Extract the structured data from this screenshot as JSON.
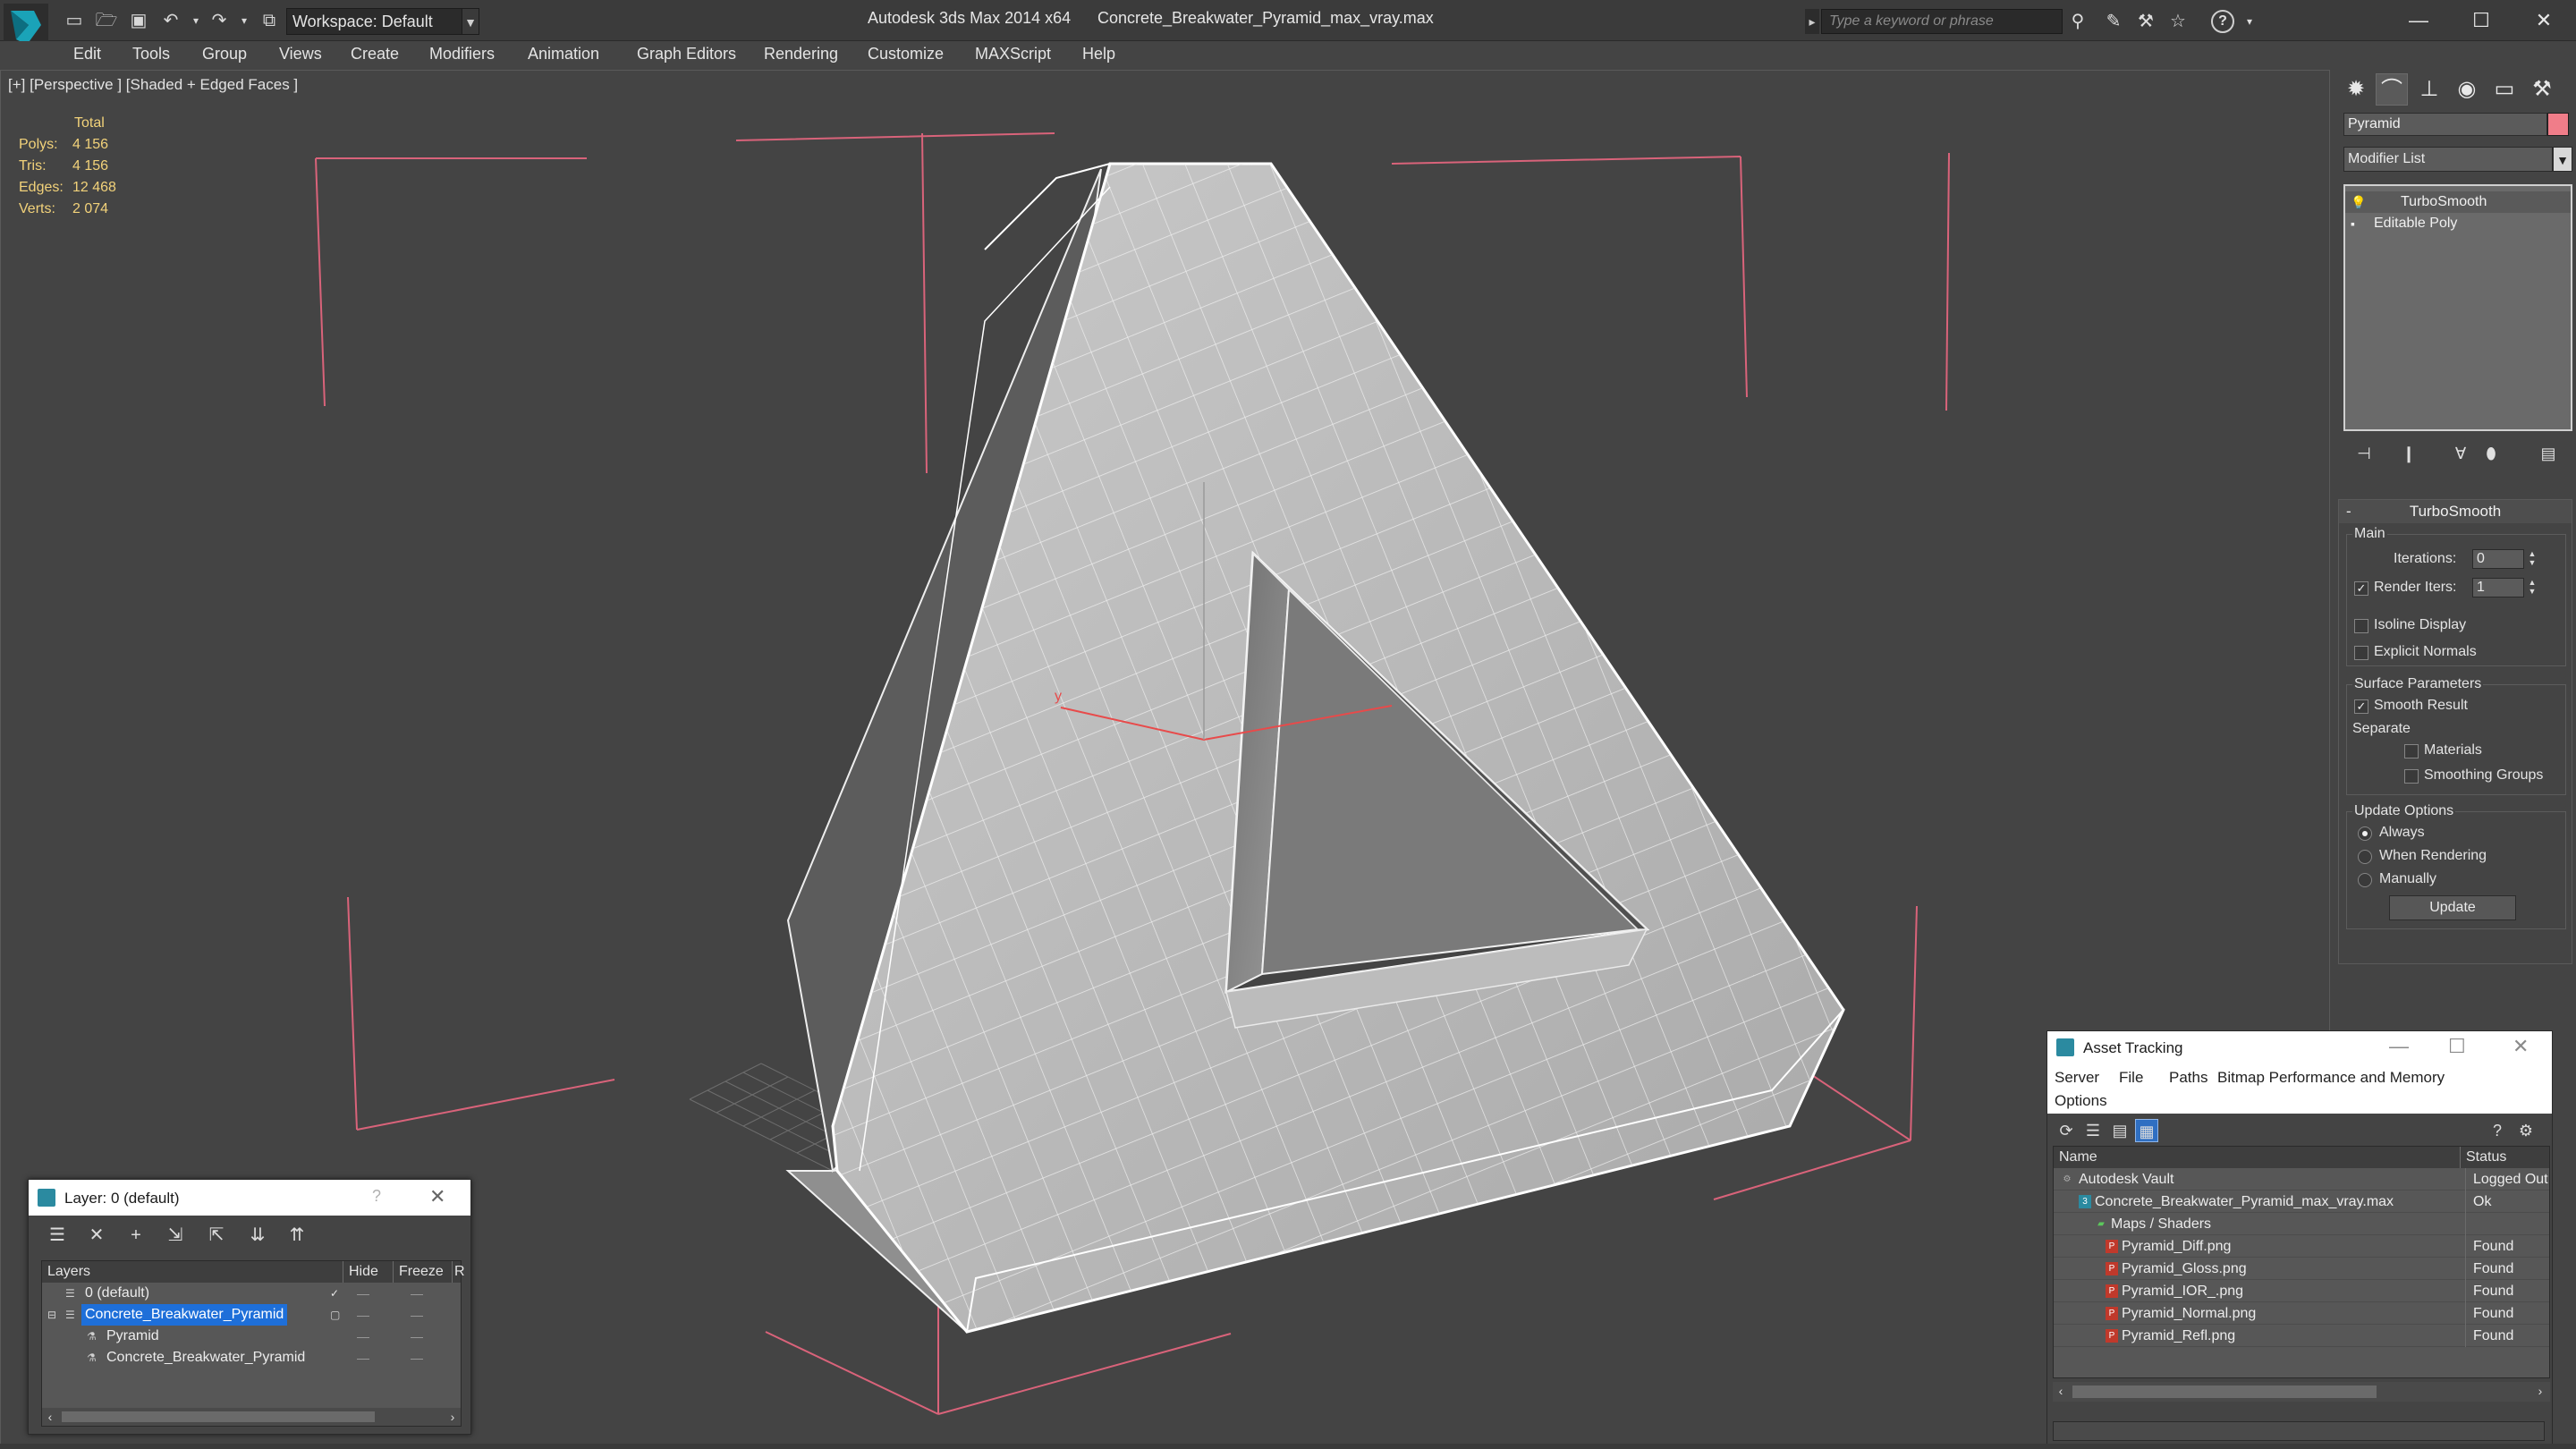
{
  "titlebar": {
    "app_title": "Autodesk 3ds Max  2014 x64",
    "file_title": "Concrete_Breakwater_Pyramid_max_vray.max",
    "workspace": "Workspace: Default",
    "search_placeholder": "Type a keyword or phrase"
  },
  "menu": [
    "Edit",
    "Tools",
    "Group",
    "Views",
    "Create",
    "Modifiers",
    "Animation",
    "Graph Editors",
    "Rendering",
    "Customize",
    "MAXScript",
    "Help"
  ],
  "viewport": {
    "label": "[+] [Perspective ] [Shaded + Edged Faces ]",
    "stats": {
      "header": "Total",
      "rows": [
        {
          "label": "Polys:",
          "value": "4 156"
        },
        {
          "label": "Tris:",
          "value": "4 156"
        },
        {
          "label": "Edges:",
          "value": "12 468"
        },
        {
          "label": "Verts:",
          "value": "2 074"
        }
      ]
    },
    "axis_label": "y"
  },
  "command_panel": {
    "object_name": "Pyramid",
    "object_color": "#f07d89",
    "modifier_list": "Modifier List",
    "stack": [
      "TurboSmooth",
      "Editable Poly"
    ],
    "turbosmooth": {
      "title": "TurboSmooth",
      "main_group": "Main",
      "iterations_label": "Iterations:",
      "iterations_value": "0",
      "render_iters_label": "Render Iters:",
      "render_iters_value": "1",
      "render_iters_checked": true,
      "isoline_label": "Isoline Display",
      "explicit_normals_label": "Explicit Normals",
      "surface_group": "Surface Parameters",
      "smooth_result_label": "Smooth Result",
      "separate_label": "Separate",
      "materials_label": "Materials",
      "smoothing_groups_label": "Smoothing Groups",
      "update_group": "Update Options",
      "always_label": "Always",
      "when_rendering_label": "When Rendering",
      "manually_label": "Manually",
      "update_button": "Update"
    }
  },
  "layer_dialog": {
    "title": "Layer: 0 (default)",
    "help": "?",
    "columns": [
      "Layers",
      "Hide",
      "Freeze",
      "R"
    ],
    "rows": [
      "0 (default)",
      "Concrete_Breakwater_Pyramid",
      "Pyramid",
      "Concrete_Breakwater_Pyramid"
    ]
  },
  "asset_dialog": {
    "title": "Asset Tracking",
    "menu": [
      "Server",
      "File",
      "Paths",
      "Bitmap Performance and Memory",
      "Options"
    ],
    "columns": [
      "Name",
      "Status"
    ],
    "rows": [
      {
        "name": "Autodesk Vault",
        "status": "Logged Out"
      },
      {
        "name": "Concrete_Breakwater_Pyramid_max_vray.max",
        "status": "Ok"
      },
      {
        "name": "Maps / Shaders",
        "status": ""
      },
      {
        "name": "Pyramid_Diff.png",
        "status": "Found"
      },
      {
        "name": "Pyramid_Gloss.png",
        "status": "Found"
      },
      {
        "name": "Pyramid_IOR_.png",
        "status": "Found"
      },
      {
        "name": "Pyramid_Normal.png",
        "status": "Found"
      },
      {
        "name": "Pyramid_Refl.png",
        "status": "Found"
      }
    ]
  },
  "colors": {
    "viewport_bg": "#444444",
    "stats_text": "#f2d27a",
    "bbox_corners": "#d9637a",
    "selection": "#1e6fd9"
  }
}
